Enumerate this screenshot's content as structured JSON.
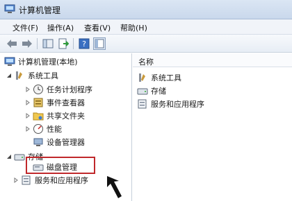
{
  "window": {
    "title": "计算机管理"
  },
  "menu": [
    {
      "label": "文件(F)"
    },
    {
      "label": "操作(A)"
    },
    {
      "label": "查看(V)"
    },
    {
      "label": "帮助(H)"
    }
  ],
  "tree": {
    "root": "计算机管理(本地)",
    "system_tools": "系统工具",
    "task_scheduler": "任务计划程序",
    "event_viewer": "事件查看器",
    "shared_folders": "共享文件夹",
    "performance": "性能",
    "device_manager": "设备管理器",
    "storage": "存储",
    "disk_management": "磁盘管理",
    "services_apps": "服务和应用程序"
  },
  "list": {
    "column_name": "名称",
    "items": [
      {
        "label": "系统工具"
      },
      {
        "label": "存储"
      },
      {
        "label": "服务和应用程序"
      }
    ]
  },
  "colors": {
    "highlight": "#c0282b",
    "titlebar": "#c9d8ec"
  }
}
